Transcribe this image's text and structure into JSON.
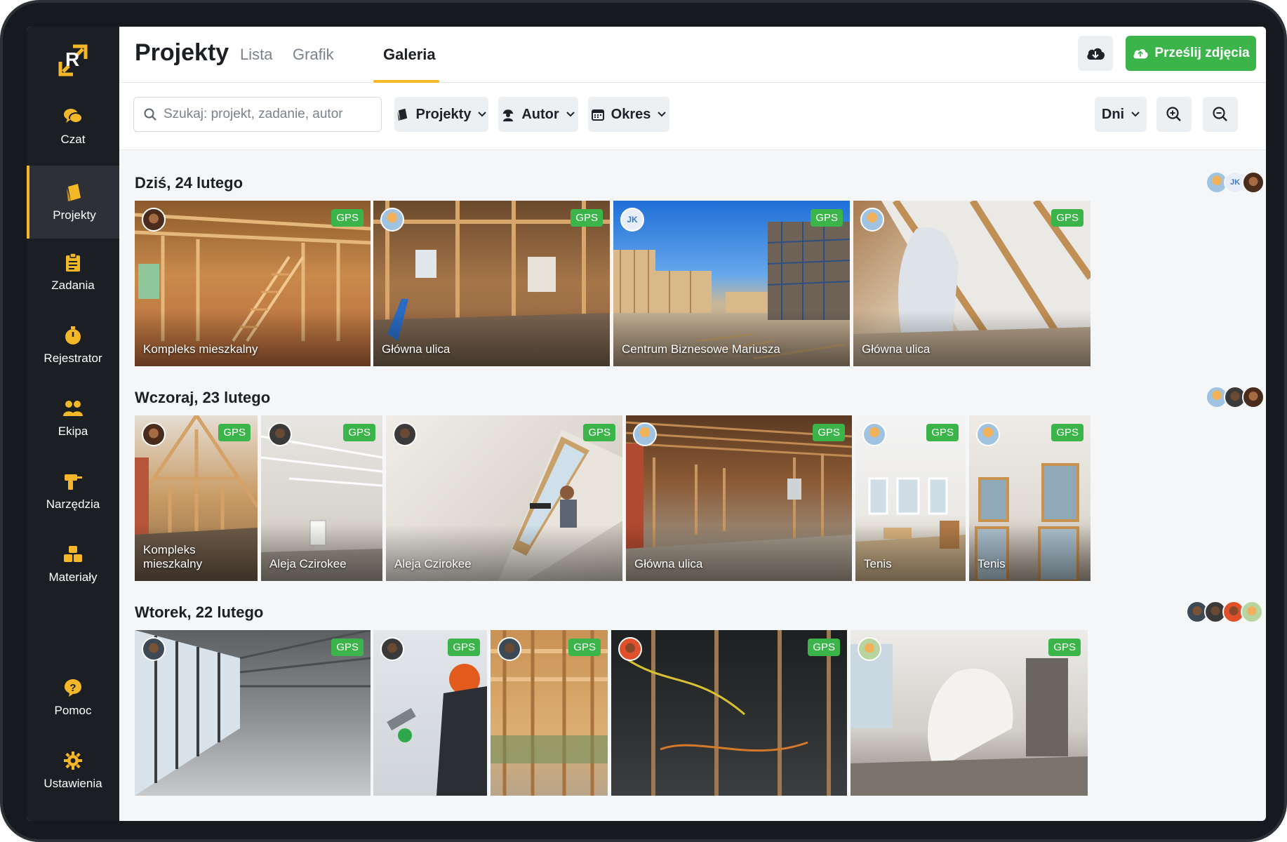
{
  "header": {
    "title": "Projekty",
    "tabs": [
      {
        "label": "Lista"
      },
      {
        "label": "Grafik"
      },
      {
        "label": "Galeria"
      }
    ],
    "upload_label": "Prześlij zdjęcia"
  },
  "sidebar": {
    "items": [
      {
        "label": "Czat",
        "icon": "chat-icon"
      },
      {
        "label": "Projekty",
        "icon": "projects-icon"
      },
      {
        "label": "Zadania",
        "icon": "clipboard-icon"
      },
      {
        "label": "Rejestrator",
        "icon": "stopwatch-icon"
      },
      {
        "label": "Ekipa",
        "icon": "team-icon"
      },
      {
        "label": "Narzędzia",
        "icon": "drill-icon"
      },
      {
        "label": "Materiały",
        "icon": "materials-icon"
      },
      {
        "label": "Pomoc",
        "icon": "help-icon"
      },
      {
        "label": "Ustawienia",
        "icon": "gear-icon"
      }
    ]
  },
  "toolbar": {
    "search_placeholder": "Szukaj: projekt, zadanie, autor",
    "filters": [
      {
        "label": "Projekty"
      },
      {
        "label": "Autor"
      },
      {
        "label": "Okres"
      }
    ],
    "period_select": "Dni"
  },
  "gallery": {
    "days": [
      {
        "label": "Dziś, 24 lutego",
        "avatars": [
          "avatar-worker",
          "avatar-jk",
          "avatar-woman"
        ],
        "photos": [
          {
            "caption": "Kompleks mieszkalny",
            "gps": "GPS",
            "scene": "framing-stairs"
          },
          {
            "caption": "Główna ulica",
            "gps": "GPS",
            "scene": "interior-framing"
          },
          {
            "caption": "Centrum Biznesowe Mariusza",
            "gps": "GPS",
            "scene": "scaffolding-sky",
            "author_initials": "JK"
          },
          {
            "caption": "Główna ulica",
            "gps": "GPS",
            "scene": "attic-insulation"
          }
        ]
      },
      {
        "label": "Wczoraj, 23 lutego",
        "avatars": [
          "avatar-worker",
          "avatar-man",
          "avatar-woman"
        ],
        "photos": [
          {
            "caption": "Kompleks mieszkalny",
            "gps": "GPS",
            "scene": "attic-framing"
          },
          {
            "caption": "Aleja Czirokee",
            "gps": "GPS",
            "scene": "drywall-room"
          },
          {
            "caption": "Aleja Czirokee",
            "gps": "GPS",
            "scene": "drywall-worker"
          },
          {
            "caption": "Główna ulica",
            "gps": "GPS",
            "scene": "basement-framing"
          },
          {
            "caption": "Tenis",
            "gps": "GPS",
            "scene": "white-room"
          },
          {
            "caption": "Tenis",
            "gps": "GPS",
            "scene": "tall-windows"
          }
        ]
      },
      {
        "label": "Wtorek, 22 lutego",
        "avatars": [
          "avatar-man",
          "avatar-man2",
          "avatar-red",
          "avatar-worker2"
        ],
        "photos": [
          {
            "gps": "GPS",
            "scene": "office-windows"
          },
          {
            "gps": "GPS",
            "scene": "ceiling-worker"
          },
          {
            "gps": "GPS",
            "scene": "roof-framing"
          },
          {
            "gps": "GPS",
            "scene": "dark-wiring"
          },
          {
            "gps": "GPS",
            "scene": "renovation"
          }
        ]
      }
    ]
  },
  "colors": {
    "accent": "#f4b728",
    "success": "#3bb54a",
    "sidebar": "#1b1e22"
  }
}
